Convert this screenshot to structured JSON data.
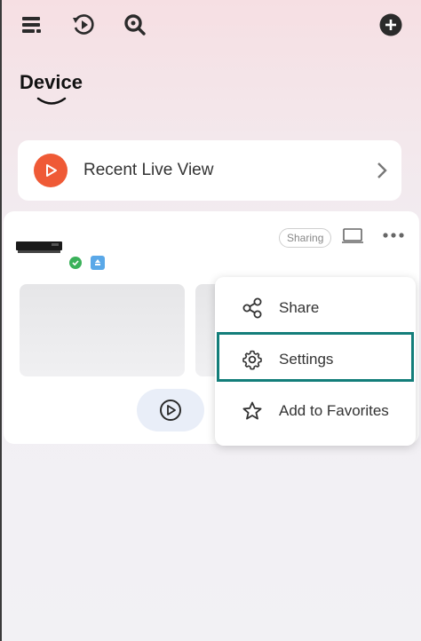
{
  "header": {
    "page_title": "Device"
  },
  "recent_live_view": {
    "label": "Recent Live View"
  },
  "device_card": {
    "sharing_badge": "Sharing"
  },
  "context_menu": {
    "items": [
      {
        "label": "Share",
        "icon": "share-icon"
      },
      {
        "label": "Settings",
        "icon": "gear-icon"
      },
      {
        "label": "Add to Favorites",
        "icon": "star-icon"
      }
    ],
    "highlighted_item": "Settings",
    "highlight_color": "#137e7a"
  },
  "colors": {
    "accent_play": "#ef5a36",
    "status_ok": "#3ab15a",
    "status_cloud": "#5aa8e8"
  }
}
